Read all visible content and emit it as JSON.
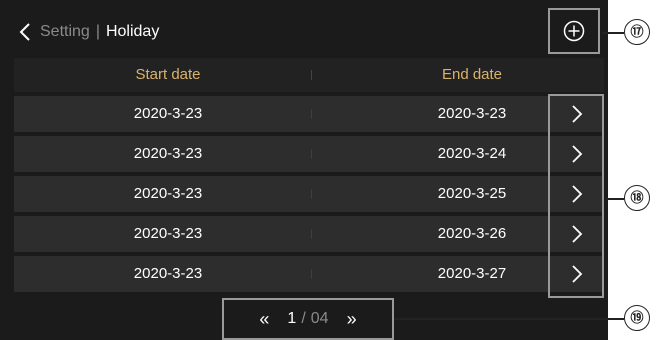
{
  "header": {
    "back_icon": "chevron-left-icon",
    "parent": "Setting",
    "separator": "|",
    "title": "Holiday",
    "add_icon": "circle-plus-icon"
  },
  "table": {
    "columns": [
      "Start date",
      "End date"
    ],
    "rows": [
      {
        "start": "2020-3-23",
        "end": "2020-3-23"
      },
      {
        "start": "2020-3-23",
        "end": "2020-3-24"
      },
      {
        "start": "2020-3-23",
        "end": "2020-3-25"
      },
      {
        "start": "2020-3-23",
        "end": "2020-3-26"
      },
      {
        "start": "2020-3-23",
        "end": "2020-3-27"
      }
    ],
    "row_arrow_icon": "chevron-right-icon"
  },
  "pager": {
    "first_label": "«",
    "current": "1",
    "separator": "/",
    "total": "04",
    "last_label": "»"
  },
  "callouts": [
    "⑰",
    "⑱",
    "⑲"
  ],
  "colors": {
    "background": "#1b1b1b",
    "row": "#2d2d2d",
    "header_text": "#d9b36c",
    "border": "#9a9a9a"
  }
}
